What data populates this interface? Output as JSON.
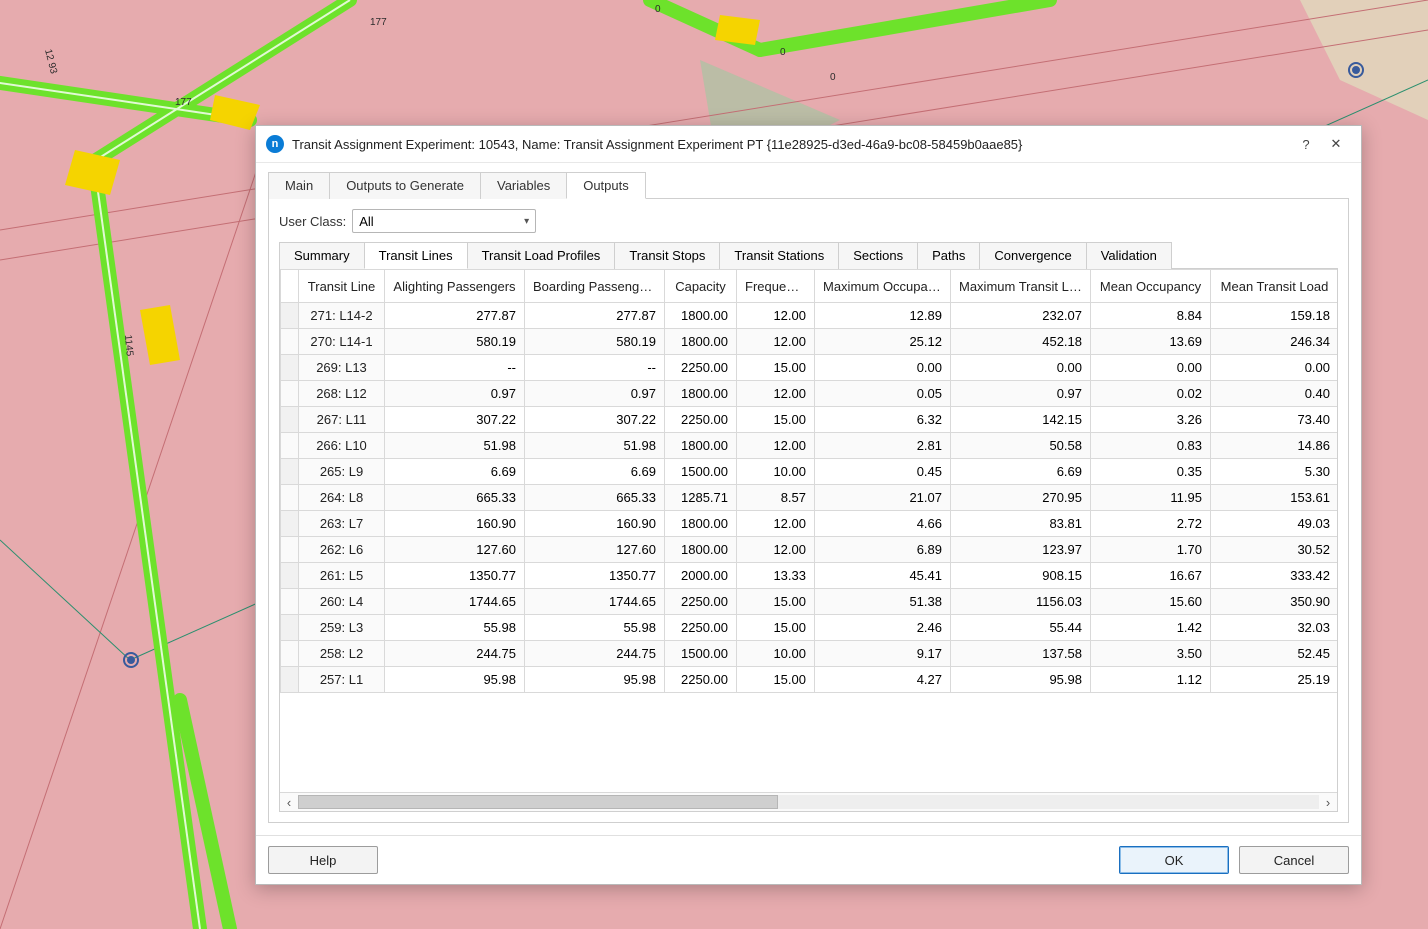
{
  "dialog": {
    "title": "Transit Assignment Experiment: 10543, Name: Transit Assignment Experiment PT  {11e28925-d3ed-46a9-bc08-58459b0aae85}",
    "icon_letter": "n",
    "help_glyph": "?",
    "close_glyph": "✕"
  },
  "top_tabs": {
    "items": [
      "Main",
      "Outputs to Generate",
      "Variables",
      "Outputs"
    ],
    "active_index": 3
  },
  "user_class": {
    "label": "User Class:",
    "value": "All"
  },
  "sub_tabs": {
    "items": [
      "Summary",
      "Transit Lines",
      "Transit Load Profiles",
      "Transit Stops",
      "Transit Stations",
      "Sections",
      "Paths",
      "Convergence",
      "Validation"
    ],
    "active_index": 1
  },
  "table": {
    "columns": [
      "Transit Line",
      "Alighting Passengers",
      "Boarding Passengers",
      "Capacity",
      "Frequency",
      "Maximum Occupancy",
      "Maximum Transit Load",
      "Mean Occupancy",
      "Mean Transit Load"
    ],
    "rows": [
      {
        "line": "271: L14-2",
        "alight": "277.87",
        "board": "277.87",
        "cap": "1800.00",
        "freq": "12.00",
        "maxocc": "12.89",
        "maxload": "232.07",
        "meanocc": "8.84",
        "meanload": "159.18"
      },
      {
        "line": "270: L14-1",
        "alight": "580.19",
        "board": "580.19",
        "cap": "1800.00",
        "freq": "12.00",
        "maxocc": "25.12",
        "maxload": "452.18",
        "meanocc": "13.69",
        "meanload": "246.34"
      },
      {
        "line": "269: L13",
        "alight": "--",
        "board": "--",
        "cap": "2250.00",
        "freq": "15.00",
        "maxocc": "0.00",
        "maxload": "0.00",
        "meanocc": "0.00",
        "meanload": "0.00"
      },
      {
        "line": "268: L12",
        "alight": "0.97",
        "board": "0.97",
        "cap": "1800.00",
        "freq": "12.00",
        "maxocc": "0.05",
        "maxload": "0.97",
        "meanocc": "0.02",
        "meanload": "0.40"
      },
      {
        "line": "267: L11",
        "alight": "307.22",
        "board": "307.22",
        "cap": "2250.00",
        "freq": "15.00",
        "maxocc": "6.32",
        "maxload": "142.15",
        "meanocc": "3.26",
        "meanload": "73.40"
      },
      {
        "line": "266: L10",
        "alight": "51.98",
        "board": "51.98",
        "cap": "1800.00",
        "freq": "12.00",
        "maxocc": "2.81",
        "maxload": "50.58",
        "meanocc": "0.83",
        "meanload": "14.86"
      },
      {
        "line": "265: L9",
        "alight": "6.69",
        "board": "6.69",
        "cap": "1500.00",
        "freq": "10.00",
        "maxocc": "0.45",
        "maxload": "6.69",
        "meanocc": "0.35",
        "meanload": "5.30"
      },
      {
        "line": "264: L8",
        "alight": "665.33",
        "board": "665.33",
        "cap": "1285.71",
        "freq": "8.57",
        "maxocc": "21.07",
        "maxload": "270.95",
        "meanocc": "11.95",
        "meanload": "153.61"
      },
      {
        "line": "263: L7",
        "alight": "160.90",
        "board": "160.90",
        "cap": "1800.00",
        "freq": "12.00",
        "maxocc": "4.66",
        "maxload": "83.81",
        "meanocc": "2.72",
        "meanload": "49.03"
      },
      {
        "line": "262: L6",
        "alight": "127.60",
        "board": "127.60",
        "cap": "1800.00",
        "freq": "12.00",
        "maxocc": "6.89",
        "maxload": "123.97",
        "meanocc": "1.70",
        "meanload": "30.52"
      },
      {
        "line": "261: L5",
        "alight": "1350.77",
        "board": "1350.77",
        "cap": "2000.00",
        "freq": "13.33",
        "maxocc": "45.41",
        "maxload": "908.15",
        "meanocc": "16.67",
        "meanload": "333.42"
      },
      {
        "line": "260: L4",
        "alight": "1744.65",
        "board": "1744.65",
        "cap": "2250.00",
        "freq": "15.00",
        "maxocc": "51.38",
        "maxload": "1156.03",
        "meanocc": "15.60",
        "meanload": "350.90"
      },
      {
        "line": "259: L3",
        "alight": "55.98",
        "board": "55.98",
        "cap": "2250.00",
        "freq": "15.00",
        "maxocc": "2.46",
        "maxload": "55.44",
        "meanocc": "1.42",
        "meanload": "32.03"
      },
      {
        "line": "258: L2",
        "alight": "244.75",
        "board": "244.75",
        "cap": "1500.00",
        "freq": "10.00",
        "maxocc": "9.17",
        "maxload": "137.58",
        "meanocc": "3.50",
        "meanload": "52.45"
      },
      {
        "line": "257: L1",
        "alight": "95.98",
        "board": "95.98",
        "cap": "2250.00",
        "freq": "15.00",
        "maxocc": "4.27",
        "maxload": "95.98",
        "meanocc": "1.12",
        "meanload": "25.19"
      }
    ]
  },
  "buttons": {
    "help": "Help",
    "ok": "OK",
    "cancel": "Cancel"
  }
}
